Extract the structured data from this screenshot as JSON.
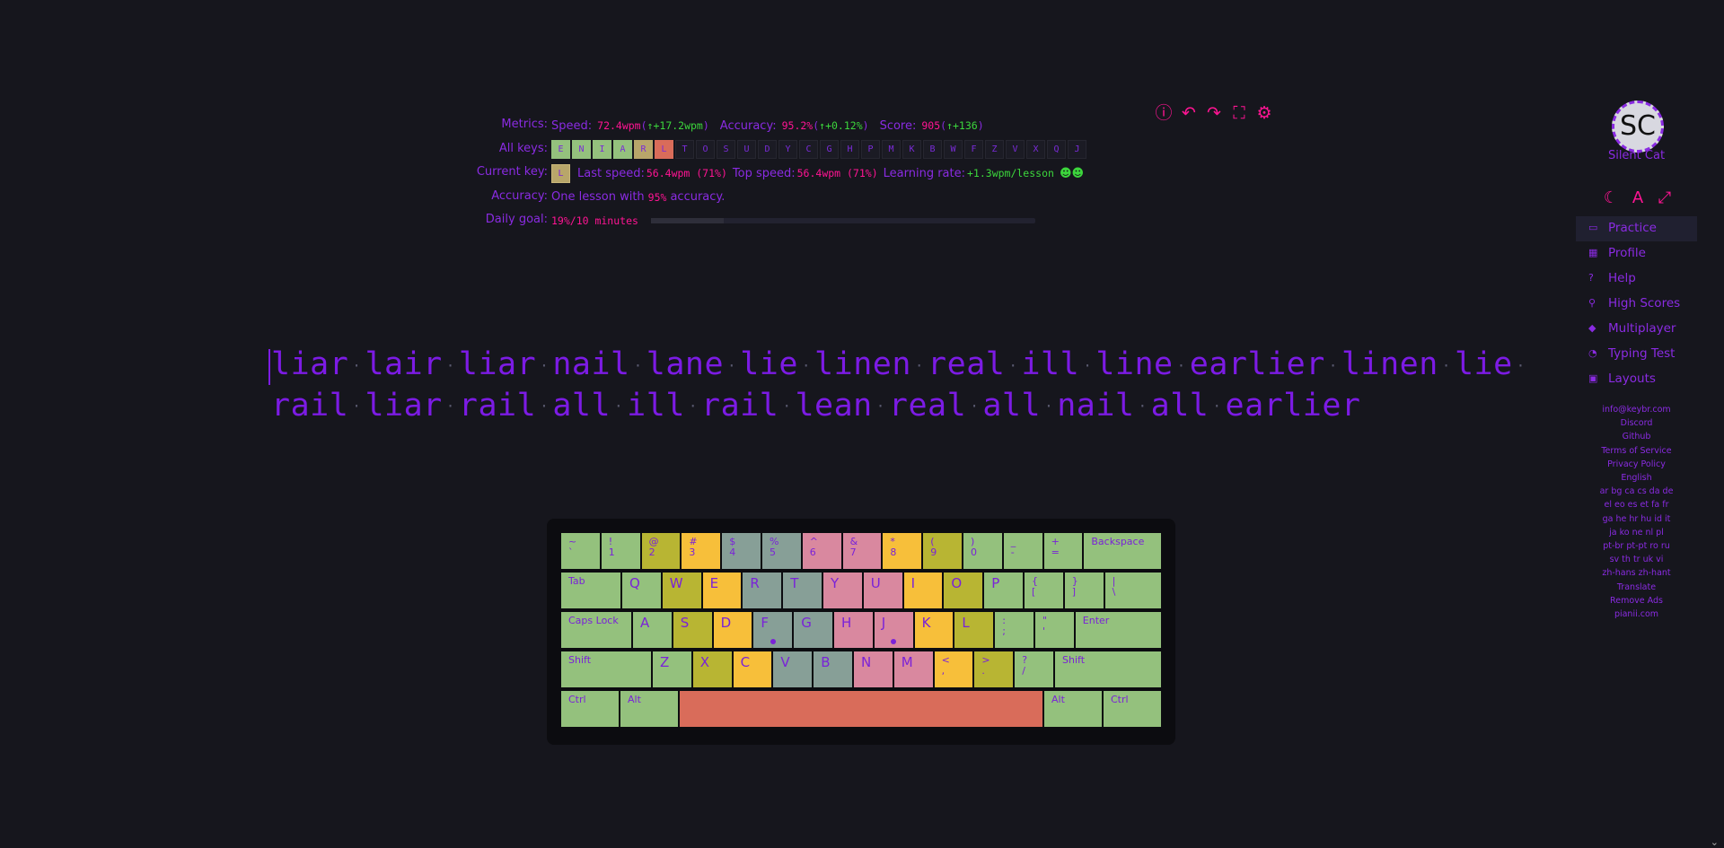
{
  "metrics": {
    "metrics_label": "Metrics:",
    "speed_label": "Speed:",
    "speed_value": "72.4wpm",
    "speed_delta": "↑+17.2wpm",
    "accuracy_label": "Accuracy:",
    "accuracy_value": "95.2%",
    "accuracy_delta": "↑+0.12%",
    "score_label": "Score:",
    "score_value": "905",
    "score_delta": "↑+136",
    "all_keys_label": "All keys:",
    "all_keys": [
      "E",
      "N",
      "I",
      "A",
      "R",
      "L",
      "T",
      "O",
      "S",
      "U",
      "D",
      "Y",
      "C",
      "G",
      "H",
      "P",
      "M",
      "K",
      "B",
      "W",
      "F",
      "Z",
      "V",
      "X",
      "Q",
      "J"
    ],
    "current_key_label": "Current key:",
    "current_key": "L",
    "last_speed_label": "Last speed:",
    "last_speed_value": "56.4wpm (71%)",
    "top_speed_label": "Top speed:",
    "top_speed_value": "56.4wpm (71%)",
    "learning_rate_label": "Learning rate:",
    "learning_rate_value": "+1.3wpm/lesson",
    "accuracy_row_label": "Accuracy:",
    "accuracy_text_pre": "One lesson with",
    "accuracy_text_val": "95%",
    "accuracy_text_post": "accuracy.",
    "daily_goal_label": "Daily goal:",
    "daily_goal_text": "19%/10 minutes",
    "daily_goal_progress": 0.19
  },
  "sidebar": {
    "avatar_initials": "SC",
    "username": "Silent Cat",
    "nav": [
      {
        "label": "Practice"
      },
      {
        "label": "Profile"
      },
      {
        "label": "Help"
      },
      {
        "label": "High Scores"
      },
      {
        "label": "Multiplayer"
      },
      {
        "label": "Typing Test"
      },
      {
        "label": "Layouts"
      }
    ],
    "links": [
      "info@keybr.com",
      "Discord",
      "Github",
      "Terms of Service",
      "Privacy Policy",
      "English",
      "ar bg ca cs da de",
      "el eo es et fa fr",
      "ga he hr hu id it",
      "ja ko ne nl pl",
      "pt-br pt-pt ro ru",
      "sv th tr uk vi",
      "zh-hans zh-hant",
      "Translate",
      "Remove Ads",
      "pianii.com"
    ]
  },
  "lesson": {
    "line1": [
      "liar",
      "lair",
      "liar",
      "nail",
      "lane",
      "lie",
      "linen",
      "real",
      "ill",
      "line",
      "earlier",
      "linen",
      "lie"
    ],
    "line2": [
      "rail",
      "liar",
      "rail",
      "all",
      "ill",
      "rail",
      "lean",
      "real",
      "all",
      "nail",
      "all",
      "earlier"
    ]
  },
  "keyboard": {
    "row1": [
      [
        "~",
        "`"
      ],
      [
        "!",
        "1"
      ],
      [
        "@",
        "2"
      ],
      [
        "#",
        "3"
      ],
      [
        "$",
        "4"
      ],
      [
        "%",
        "5"
      ],
      [
        "^",
        "6"
      ],
      [
        "&",
        "7"
      ],
      [
        "*",
        "8"
      ],
      [
        "(",
        "9"
      ],
      [
        ")",
        "0"
      ],
      [
        "_",
        "-"
      ],
      [
        "+",
        "="
      ]
    ],
    "backspace": "Backspace",
    "tab": "Tab",
    "row2": [
      "Q",
      "W",
      "E",
      "R",
      "T",
      "Y",
      "U",
      "I",
      "O",
      "P"
    ],
    "row2_sym": [
      [
        "{",
        "["
      ],
      [
        "}",
        "]"
      ],
      [
        "|",
        "\\"
      ]
    ],
    "caps": "Caps Lock",
    "row3": [
      "A",
      "S",
      "D",
      "F",
      "G",
      "H",
      "J",
      "K",
      "L"
    ],
    "row3_sym": [
      [
        ":",
        ";"
      ],
      [
        "\"",
        "'"
      ]
    ],
    "enter": "Enter",
    "shift_l": "Shift",
    "row4": [
      "Z",
      "X",
      "C",
      "V",
      "B",
      "N",
      "M"
    ],
    "row4_sym": [
      [
        "<",
        ","
      ],
      [
        ">",
        "."
      ],
      [
        "?",
        "/"
      ]
    ],
    "shift_r": "Shift",
    "ctrl_l": "Ctrl",
    "alt_l": "Alt",
    "alt_r": "Alt",
    "ctrl_r": "Ctrl"
  }
}
